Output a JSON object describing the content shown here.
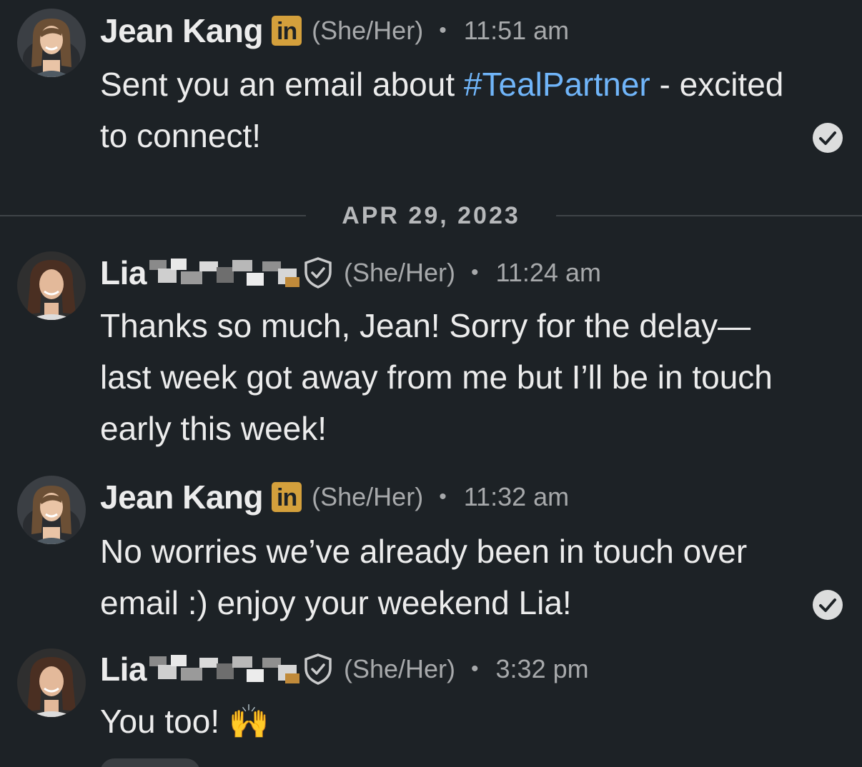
{
  "date_divider": "APR 29, 2023",
  "messages": [
    {
      "sender": "Jean Kang",
      "pronouns": "(She/Her)",
      "time": "11:51 am",
      "badge": "in",
      "text_before": "Sent you an email about ",
      "hashtag": "#TealPartner",
      "text_after": " - excited to connect!",
      "read_receipt": "check-circle-icon"
    },
    {
      "sender": "Lia",
      "pronouns": "(She/Her)",
      "time": "11:24 am",
      "text": "Thanks so much, Jean! Sorry for the delay— last week got away from me but I’ll be in touch early this week!"
    },
    {
      "sender": "Jean Kang",
      "pronouns": "(She/Her)",
      "time": "11:32 am",
      "badge": "in",
      "text": "No worries we’ve already been in touch over email :) enjoy your weekend Lia!",
      "read_receipt": "check-circle-icon"
    },
    {
      "sender": "Lia",
      "pronouns": "(She/Her)",
      "time": "3:32 pm",
      "text": "You too! 🙌"
    }
  ],
  "colors": {
    "background": "#1d2226",
    "text": "#ececec",
    "muted": "#a7a9ab",
    "hashtag": "#70b5f9",
    "linkedin_badge": "#d4a03c"
  }
}
